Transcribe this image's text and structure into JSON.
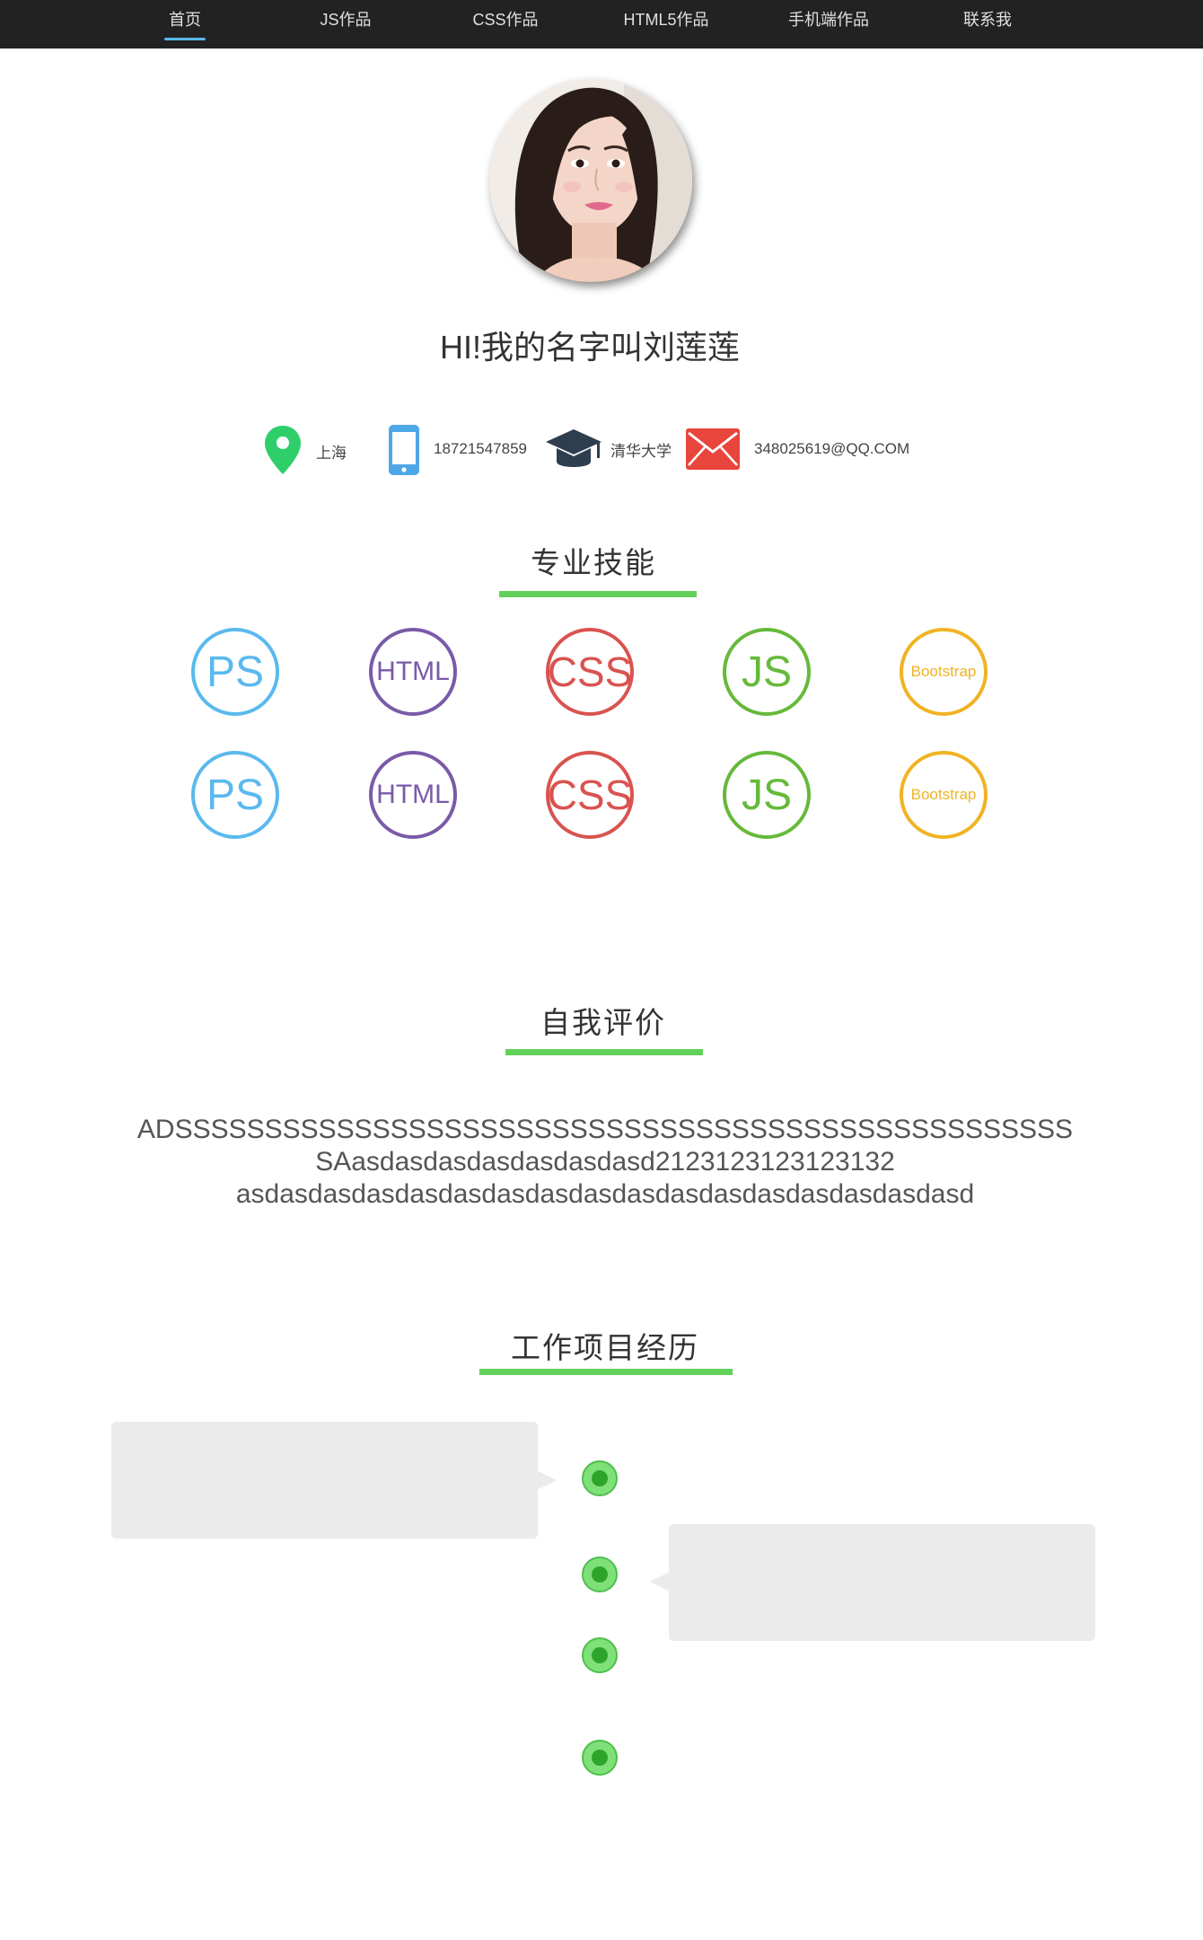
{
  "nav": {
    "items": [
      {
        "label": "首页",
        "active": true
      },
      {
        "label": "JS作品",
        "active": false
      },
      {
        "label": "CSS作品",
        "active": false
      },
      {
        "label": "HTML5作品",
        "active": false
      },
      {
        "label": "手机端作品",
        "active": false
      },
      {
        "label": "联系我",
        "active": false
      }
    ]
  },
  "profile": {
    "name": "HI!我的名字叫刘莲莲",
    "location": "上海",
    "phone": "18721547859",
    "school": "清华大学",
    "email": "348025619@QQ.COM"
  },
  "skills_section": {
    "title": "专业技能",
    "rows": [
      [
        {
          "label": "PS",
          "color": "#5ab9ee"
        },
        {
          "label": "HTML",
          "color": "#7a5aa8"
        },
        {
          "label": "CSS",
          "color": "#d9534f"
        },
        {
          "label": "JS",
          "color": "#66b93a"
        },
        {
          "label": "Bootstrap",
          "color": "#f0b323"
        }
      ],
      [
        {
          "label": "PS",
          "color": "#5ab9ee"
        },
        {
          "label": "HTML",
          "color": "#7a5aa8"
        },
        {
          "label": "CSS",
          "color": "#d9534f"
        },
        {
          "label": "JS",
          "color": "#66b93a"
        },
        {
          "label": "Bootstrap",
          "color": "#f0b323"
        }
      ]
    ]
  },
  "eval_section": {
    "title": "自我评价",
    "lines": [
      "ADSSSSSSSSSSSSSSSSSSSSSSSSSSSSSSSSSSSSSSSSSSSSSSSSSS",
      "SAasdasdasdasdasdasdasd2123123123123132",
      "asdasdasdasdasdasdasdasdasdasdasdasdasdasdasdasdasd"
    ]
  },
  "work_section": {
    "title": "工作项目经历"
  },
  "colors": {
    "accent_green": "#62d15a",
    "nav_bg": "#222222",
    "nav_active_underline": "#59b7ee"
  }
}
